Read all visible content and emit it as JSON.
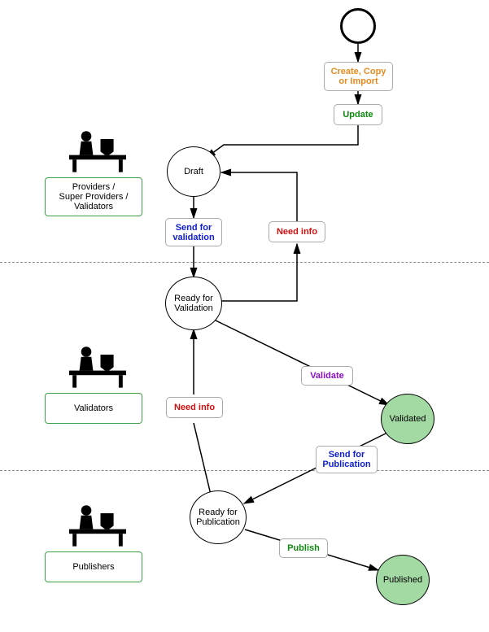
{
  "diagram": {
    "type": "workflow",
    "swimlanes": [
      {
        "role_label": "Providers /\nSuper Providers /\nValidators"
      },
      {
        "role_label": "Validators"
      },
      {
        "role_label": "Publishers"
      }
    ],
    "states": {
      "start": "",
      "draft": "Draft",
      "ready_validation": "Ready for\nValidation",
      "validated": "Validated",
      "ready_publication": "Ready for\nPublication",
      "published": "Published"
    },
    "actions": {
      "create": "Create, Copy\nor Import",
      "update": "Update",
      "send_validation": "Send for\nvalidation",
      "need_info_1": "Need info",
      "validate": "Validate",
      "need_info_2": "Need info",
      "send_publication": "Send for\nPublication",
      "publish": "Publish"
    },
    "colors": {
      "orange": "#e78a1f",
      "green": "#108a10",
      "blue": "#1020d0",
      "red": "#d01010",
      "purple": "#8a10c0",
      "role_border": "#3fa24a",
      "state_green_fill": "#a3d9a3"
    }
  }
}
